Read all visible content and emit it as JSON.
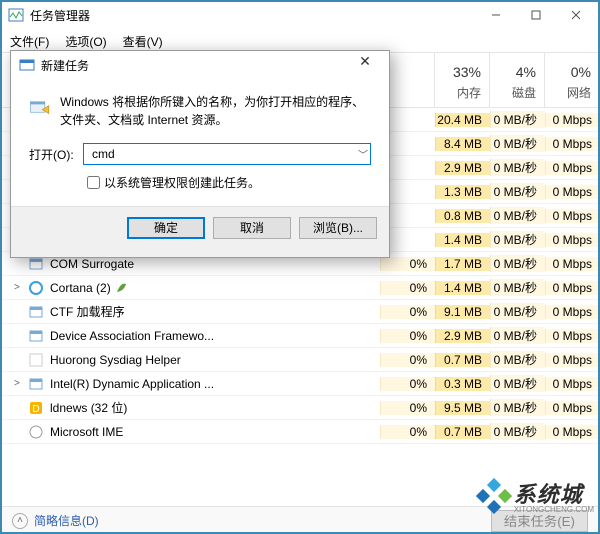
{
  "window": {
    "title": "任务管理器",
    "menu": {
      "file": "文件(F)",
      "options": "选项(O)",
      "view": "查看(V)"
    }
  },
  "headers": {
    "name": "",
    "cpu_pct": "",
    "cpu_lbl": "",
    "mem_pct": "33%",
    "mem_lbl": "内存",
    "disk_pct": "4%",
    "disk_lbl": "磁盘",
    "net_pct": "0%",
    "net_lbl": "网络"
  },
  "rows": [
    {
      "name": "",
      "cpu": "",
      "mem": "20.4 MB",
      "disk": "0 MB/秒",
      "net": "0 Mbps",
      "expand": "",
      "icon": "none"
    },
    {
      "name": "",
      "cpu": "",
      "mem": "8.4 MB",
      "disk": "0 MB/秒",
      "net": "0 Mbps",
      "expand": "",
      "icon": "none"
    },
    {
      "name": "",
      "cpu": "",
      "mem": "2.9 MB",
      "disk": "0 MB/秒",
      "net": "0 Mbps",
      "expand": "",
      "icon": "none"
    },
    {
      "name": "",
      "cpu": "",
      "mem": "1.3 MB",
      "disk": "0 MB/秒",
      "net": "0 Mbps",
      "expand": "",
      "icon": "none"
    },
    {
      "name": "",
      "cpu": "",
      "mem": "0.8 MB",
      "disk": "0 MB/秒",
      "net": "0 Mbps",
      "expand": "",
      "icon": "none"
    },
    {
      "name": "",
      "cpu": "",
      "mem": "1.4 MB",
      "disk": "0 MB/秒",
      "net": "0 Mbps",
      "expand": "",
      "icon": "none"
    },
    {
      "name": "COM Surrogate",
      "cpu": "0%",
      "mem": "1.7 MB",
      "disk": "0 MB/秒",
      "net": "0 Mbps",
      "expand": "",
      "icon": "exe"
    },
    {
      "name": "Cortana (2)",
      "cpu": "0%",
      "mem": "1.4 MB",
      "disk": "0 MB/秒",
      "net": "0 Mbps",
      "expand": ">",
      "icon": "cortana",
      "leaf": true
    },
    {
      "name": "CTF 加载程序",
      "cpu": "0%",
      "mem": "9.1 MB",
      "disk": "0 MB/秒",
      "net": "0 Mbps",
      "expand": "",
      "icon": "exe"
    },
    {
      "name": "Device Association Framewo...",
      "cpu": "0%",
      "mem": "2.9 MB",
      "disk": "0 MB/秒",
      "net": "0 Mbps",
      "expand": "",
      "icon": "exe"
    },
    {
      "name": "Huorong Sysdiag Helper",
      "cpu": "0%",
      "mem": "0.7 MB",
      "disk": "0 MB/秒",
      "net": "0 Mbps",
      "expand": "",
      "icon": "blank"
    },
    {
      "name": "Intel(R) Dynamic Application ...",
      "cpu": "0%",
      "mem": "0.3 MB",
      "disk": "0 MB/秒",
      "net": "0 Mbps",
      "expand": ">",
      "icon": "exe"
    },
    {
      "name": "ldnews (32 位)",
      "cpu": "0%",
      "mem": "9.5 MB",
      "disk": "0 MB/秒",
      "net": "0 Mbps",
      "expand": "",
      "icon": "ld"
    },
    {
      "name": "Microsoft IME",
      "cpu": "0%",
      "mem": "0.7 MB",
      "disk": "0 MB/秒",
      "net": "0 Mbps",
      "expand": "",
      "icon": "ime"
    }
  ],
  "footer": {
    "brief": "简略信息(D)",
    "end_task": "结束任务(E)"
  },
  "dialog": {
    "title": "新建任务",
    "desc": "Windows 将根据你所键入的名称，为你打开相应的程序、文件夹、文档或 Internet 资源。",
    "open_label": "打开(O):",
    "value": "cmd",
    "checkbox": "以系统管理权限创建此任务。",
    "ok": "确定",
    "cancel": "取消",
    "browse": "浏览(B)..."
  },
  "watermark": {
    "name": "系统城",
    "sub": "XITONGCHENG.COM"
  }
}
